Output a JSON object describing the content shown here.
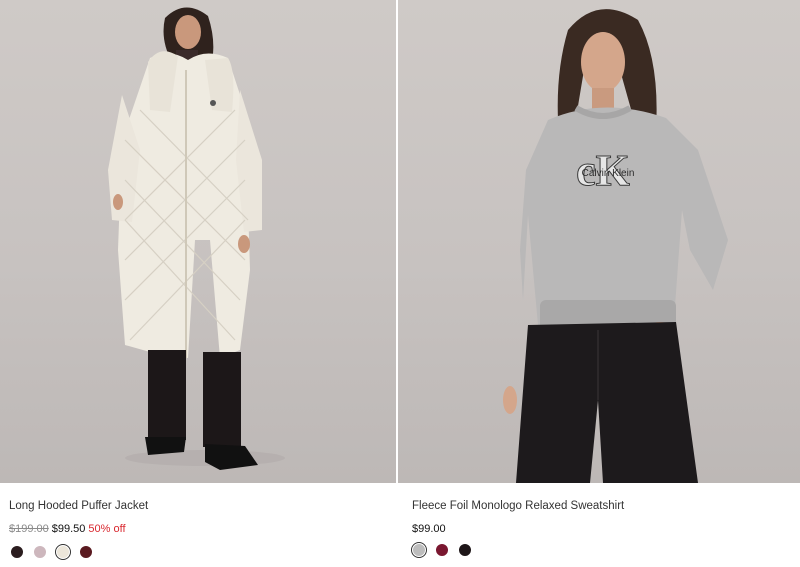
{
  "products": [
    {
      "title": "Long Hooded Puffer Jacket",
      "original_price": "$199.00",
      "price": "$99.50",
      "discount": "50% off",
      "image_subject": "model wearing long cream quilted puffer jacket",
      "swatches": [
        {
          "color": "#2b1d1f",
          "selected": false
        },
        {
          "color": "#cdb7bd",
          "selected": false
        },
        {
          "color": "#ece6da",
          "selected": true
        },
        {
          "color": "#5a1a20",
          "selected": false
        }
      ]
    },
    {
      "title": "Fleece Foil Monologo Relaxed Sweatshirt",
      "price": "$99.00",
      "image_subject": "model wearing grey sweatshirt with Calvin Klein monogram and black wide-leg jeans",
      "logo_text": "Calvin Klein",
      "swatches": [
        {
          "color": "#bdbdbd",
          "selected": true
        },
        {
          "color": "#7a1730",
          "selected": false
        },
        {
          "color": "#1e1618",
          "selected": false
        }
      ]
    }
  ],
  "colors": {
    "sale": "#d9282f",
    "strike": "#8a8a8a",
    "background": "#cfcac7"
  }
}
